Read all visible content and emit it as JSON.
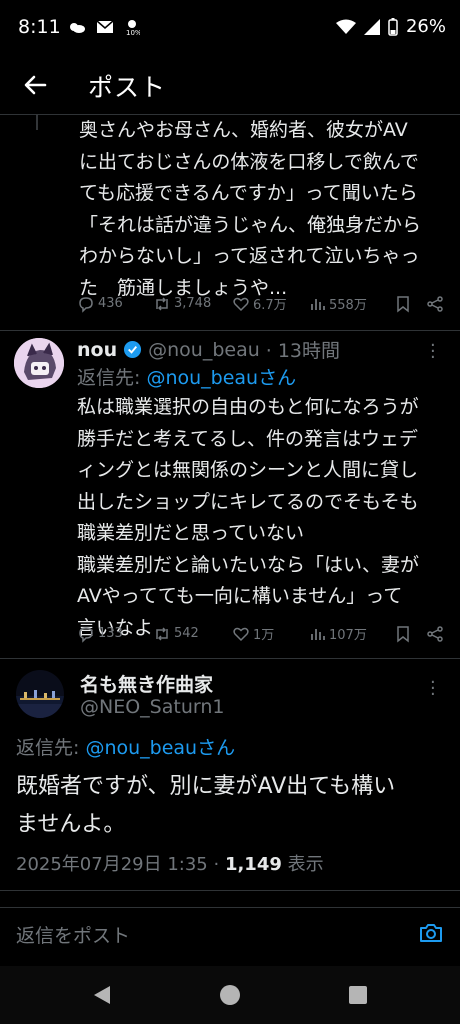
{
  "status_bar": {
    "time": "8:11",
    "battery": "26%"
  },
  "header": {
    "title": "ポスト"
  },
  "post1": {
    "text": "奥さんやお母さん、婚約者、彼女がAV\nに出ておじさんの体液を口移しで飲んで\nても応援できるんですか」って聞いたら\n「それは話が違うじゃん、俺独身だから\nわからないし」って返されて泣いちゃっ\nた　筋通しましょうや...",
    "replies": "436",
    "reposts": "3,748",
    "likes": "6.7万",
    "views": "558万"
  },
  "post2": {
    "name": "nou",
    "handle": "@nou_beau",
    "time": "· 13時間",
    "reply_to_label": "返信先: ",
    "reply_to_handle": "@nou_beauさん",
    "text": "私は職業選択の自由のもと何になろうが\n勝手だと考えてるし、件の発言はウェデ\nィングとは無関係のシーンと人間に貸し\n出したショップにキレてるのでそもそも\n職業差別だと思っていない\n職業差別だと論いたいなら「はい、妻が\nAVやってても一向に構いません」って\n言いなよ",
    "replies": "133",
    "reposts": "542",
    "likes": "1万",
    "views": "107万"
  },
  "post3": {
    "name": "名も無き作曲家",
    "handle": "@NEO_Saturn1",
    "reply_to_label": "返信先: ",
    "reply_to_handle": "@nou_beauさん",
    "text": "既婚者ですが、別に妻がAV出ても構い\nませんよ。",
    "date": "2025年07月29日 1:35 · ",
    "view_count": "1,149",
    "view_label": " 表示"
  },
  "reply_box": {
    "placeholder": "返信をポスト"
  },
  "colors": {
    "accent": "#1d9bf0",
    "muted": "#71767b",
    "background": "#000000"
  }
}
